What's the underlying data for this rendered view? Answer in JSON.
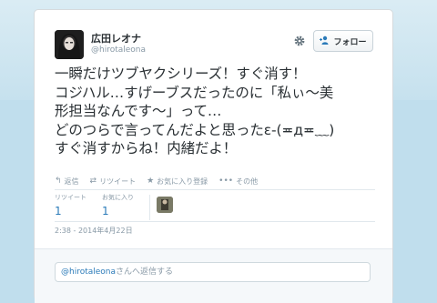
{
  "user": {
    "display_name": "広田レオナ",
    "username": "@hirotaleona"
  },
  "header": {
    "gear_icon": "gear-icon",
    "follow_label": "フォロー",
    "follow_icon": "follow-user-icon"
  },
  "tweet": {
    "text": "一瞬だけツブヤクシリーズ！すぐ消す！\nコジハル…すげーブスだったのに「私ぃ〜美\n形担当なんです〜」って…\nどのつらで言ってんだよと思ったε-(≖д≖﹏)\nすぐ消すからね！内緒だよ！"
  },
  "actions": {
    "reply_label": "返信",
    "retweet_label": "リツイート",
    "favorite_label": "お気に入り登録",
    "more_label": "その他"
  },
  "stats": {
    "retweets_label": "リツイート",
    "retweets_value": "1",
    "favorites_label": "お気に入り",
    "favorites_value": "1"
  },
  "timestamp": "2:38 - 2014年4月22日",
  "reply": {
    "handle": "@hirotaleona",
    "suffix": "さんへ返信する"
  },
  "colors": {
    "link": "#2b7bb9",
    "background": "#c0deed"
  }
}
